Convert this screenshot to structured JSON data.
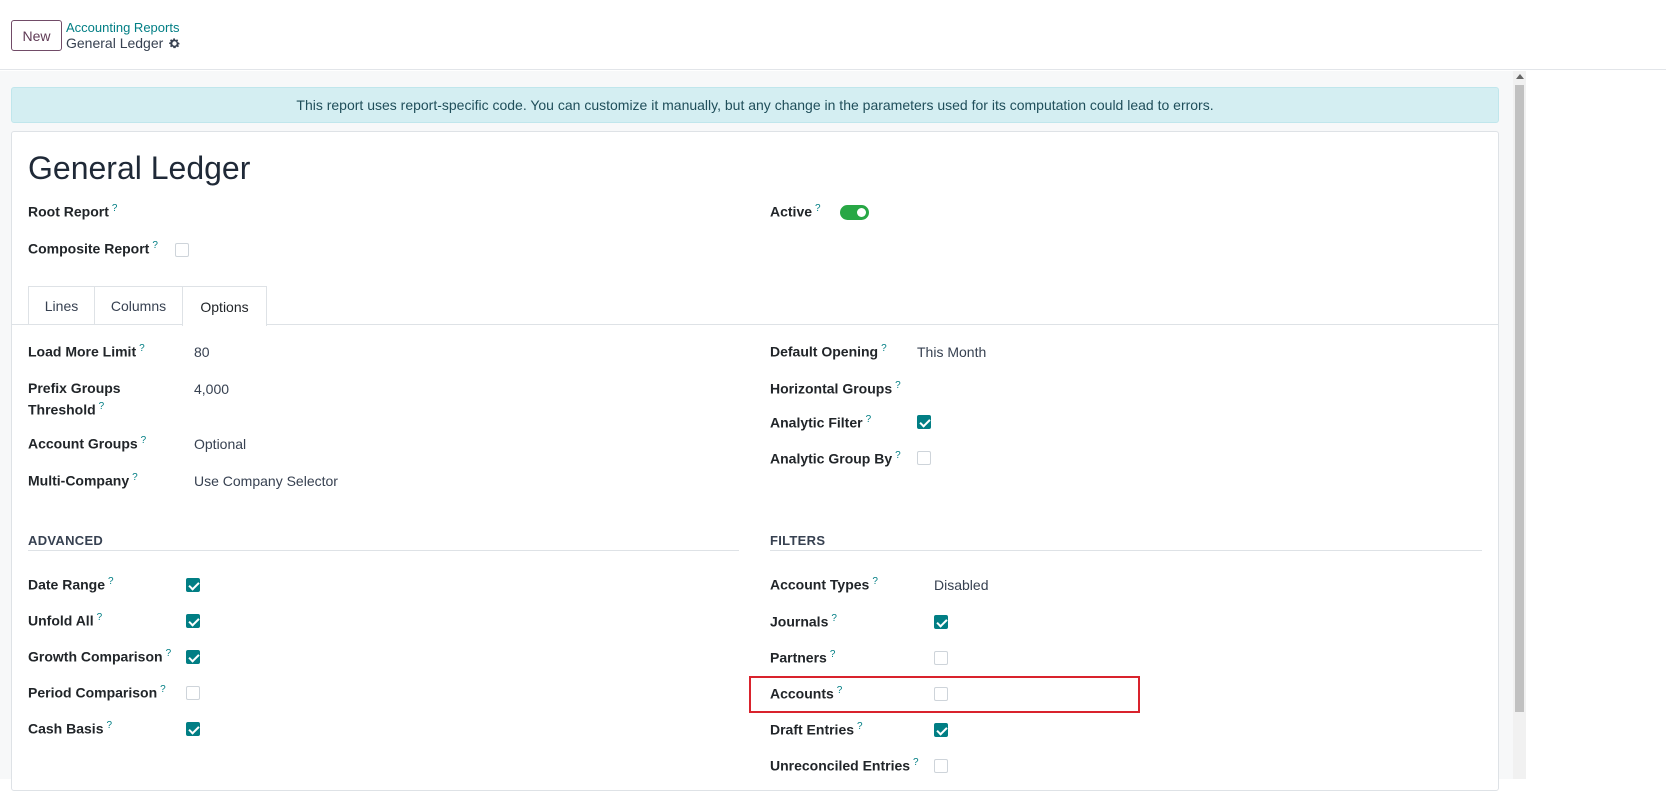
{
  "topbar": {
    "new_label": "New",
    "breadcrumb_parent": "Accounting Reports",
    "breadcrumb_current": "General Ledger"
  },
  "alert": "This report uses report-specific code. You can customize it manually, but any change in the parameters used for its computation could lead to errors.",
  "form": {
    "title": "General Ledger",
    "root_report_label": "Root Report",
    "composite_report_label": "Composite Report",
    "composite_report_checked": false,
    "active_label": "Active",
    "active_on": true
  },
  "tabs": [
    "Lines",
    "Columns",
    "Options"
  ],
  "active_tab": "Options",
  "options": {
    "load_more_limit_label": "Load More Limit",
    "load_more_limit_value": "80",
    "prefix_groups_label_1": "Prefix Groups",
    "prefix_groups_label_2": "Threshold",
    "prefix_groups_value": "4,000",
    "account_groups_label": "Account Groups",
    "account_groups_value": "Optional",
    "multi_company_label": "Multi-Company",
    "multi_company_value": "Use Company Selector",
    "default_opening_label": "Default Opening",
    "default_opening_value": "This Month",
    "horizontal_groups_label": "Horizontal Groups",
    "analytic_filter_label": "Analytic Filter",
    "analytic_filter_checked": true,
    "analytic_group_by_label": "Analytic Group By",
    "analytic_group_by_checked": false
  },
  "advanced": {
    "heading": "ADVANCED",
    "items": [
      {
        "label": "Date Range",
        "checked": true
      },
      {
        "label": "Unfold All",
        "checked": true
      },
      {
        "label": "Growth Comparison",
        "checked": true
      },
      {
        "label": "Period Comparison",
        "checked": false
      },
      {
        "label": "Cash Basis",
        "checked": true
      }
    ]
  },
  "filters": {
    "heading": "FILTERS",
    "account_types_label": "Account Types",
    "account_types_value": "Disabled",
    "items": [
      {
        "label": "Journals",
        "checked": true
      },
      {
        "label": "Partners",
        "checked": false
      },
      {
        "label": "Accounts",
        "checked": false
      },
      {
        "label": "Draft Entries",
        "checked": true
      },
      {
        "label": "Unreconciled Entries",
        "checked": false
      }
    ]
  },
  "help_marker": "?",
  "colors": {
    "brand": "#714b67",
    "accent": "#017e84",
    "toggle_on": "#28a745",
    "highlight": "#d9232d"
  }
}
